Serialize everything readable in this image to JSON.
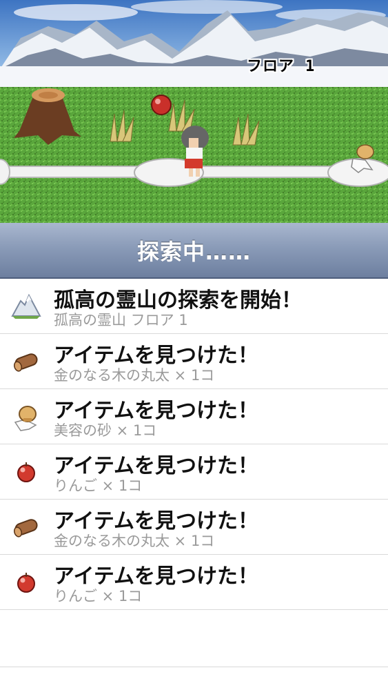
{
  "scene": {
    "floor_label": "フロア",
    "floor_number": "1",
    "colors": {
      "sky": "#4f86c9",
      "grass": "#58a83a",
      "path": "#f2f2f2"
    }
  },
  "status": {
    "text": "探索中……"
  },
  "log": [
    {
      "icon": "mountain-icon",
      "title": "孤高の霊山の探索を開始！",
      "sub": "孤高の霊山 フロア 1"
    },
    {
      "icon": "log-icon",
      "title": "アイテムを見つけた！",
      "sub": "金のなる木の丸太 × 1コ"
    },
    {
      "icon": "sand-bag-icon",
      "title": "アイテムを見つけた！",
      "sub": "美容の砂 × 1コ"
    },
    {
      "icon": "apple-icon",
      "title": "アイテムを見つけた！",
      "sub": "りんご × 1コ"
    },
    {
      "icon": "log-icon",
      "title": "アイテムを見つけた！",
      "sub": "金のなる木の丸太 × 1コ"
    },
    {
      "icon": "apple-icon",
      "title": "アイテムを見つけた！",
      "sub": "りんご × 1コ"
    }
  ]
}
